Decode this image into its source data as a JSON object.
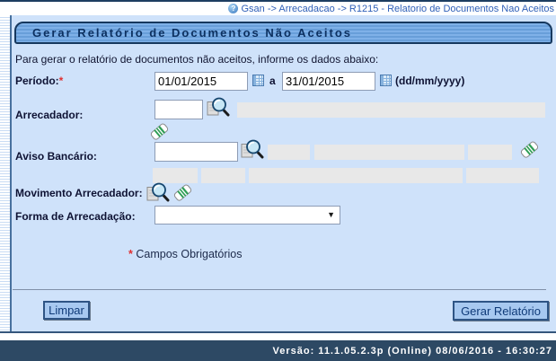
{
  "window": {
    "breadcrumb": "Gsan -> Arrecadacao -> R1215 - Relatorio de Documentos Nao Aceitos"
  },
  "icons": {
    "help": "?",
    "dropdown_arrow": "▼",
    "calendar": "calendar-grid",
    "search": "magnifier-with-document",
    "clear": "eraser"
  },
  "page": {
    "title": "Gerar Relatório de Documentos Não Aceitos",
    "intro": "Para gerar o relatório de documentos não aceitos, informe os dados abaixo:"
  },
  "form": {
    "periodo": {
      "label": "Período:",
      "required_marker": "*",
      "date_from": "01/01/2015",
      "separator": "a",
      "date_to": "31/01/2015",
      "format_hint": "(dd/mm/yyyy)"
    },
    "arrecadador": {
      "label": "Arrecadador:",
      "code": "",
      "name": ""
    },
    "aviso_bancario": {
      "label": "Aviso Bancário:",
      "code": "",
      "info": [
        "",
        "",
        ""
      ],
      "info2": [
        "",
        "",
        "",
        ""
      ]
    },
    "movimento_arrecadador": {
      "label": "Movimento Arrecadador:"
    },
    "forma_arrecadacao": {
      "label": "Forma de Arrecadação:",
      "selected": ""
    }
  },
  "notes": {
    "required_marker": "*",
    "required_text": "Campos Obrigatórios"
  },
  "actions": {
    "limpar": "Limpar",
    "gerar": "Gerar Relatório"
  },
  "footer": {
    "version_text": "Versão: 11.1.05.2.3p (Online) 08/06/2016 - 16:30:27"
  },
  "colors": {
    "panel_bg": "#cfe2fa",
    "title_bar_blue": "#689ed9",
    "footer_bg": "#2d4964",
    "button_bg": "#a7c8f0",
    "button_border": "#2e5485",
    "breadcrumb_blue": "#3060b8",
    "required_red": "#e03030",
    "readonly_gray": "#e8e8e8"
  }
}
